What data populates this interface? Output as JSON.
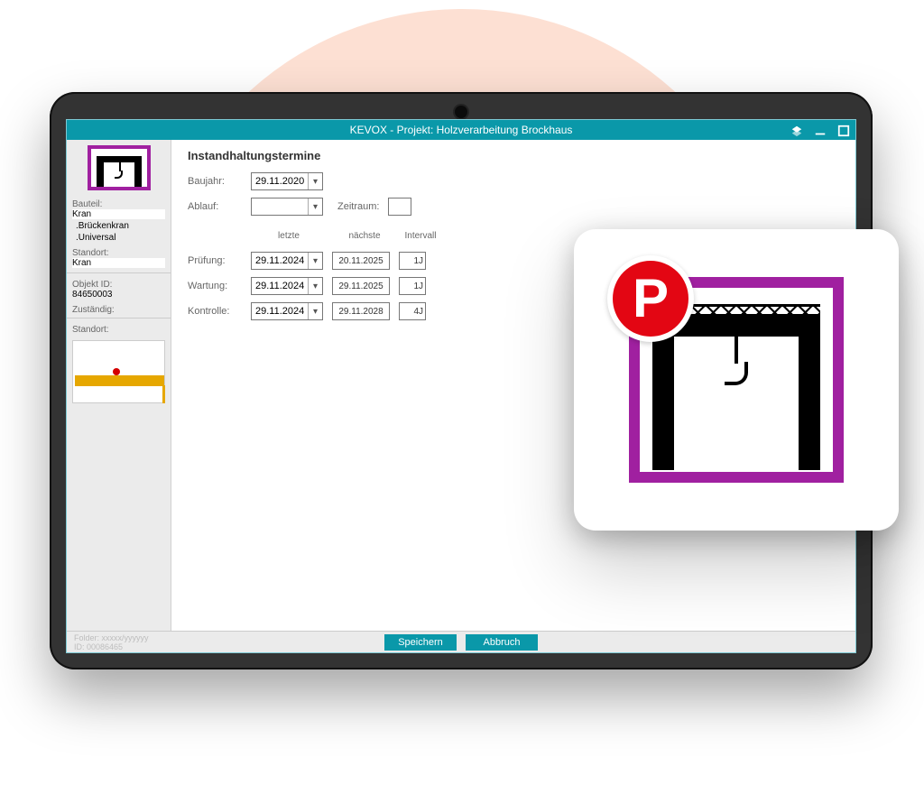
{
  "titlebar": {
    "text": "KEVOX - Projekt: Holzverarbeitung Brockhaus"
  },
  "sidebar": {
    "bauteil_label": "Bauteil:",
    "bauteil_values": [
      "Kran",
      ".Brückenkran",
      ".Universal"
    ],
    "standort_label": "Standort:",
    "standort_value": "Kran",
    "objekt_id_label": "Objekt ID:",
    "objekt_id_value": "84650003",
    "zustaendig_label": "Zuständig:",
    "standort2_label": "Standort:"
  },
  "main": {
    "heading": "Instandhaltungstermine",
    "baujahr_label": "Baujahr:",
    "baujahr_value": "29.11.2020",
    "ablauf_label": "Ablauf:",
    "zeitraum_label": "Zeitraum:",
    "col_letzte": "letzte",
    "col_naechste": "nächste",
    "col_intervall": "Intervall",
    "rows": [
      {
        "label": "Prüfung:",
        "letzte": "29.11.2024",
        "naechste": "20.11.2025",
        "intervall": "1J"
      },
      {
        "label": "Wartung:",
        "letzte": "29.11.2024",
        "naechste": "29.11.2025",
        "intervall": "1J"
      },
      {
        "label": "Kontrolle:",
        "letzte": "29.11.2024",
        "naechste": "29.11.2028",
        "intervall": "4J"
      }
    ]
  },
  "footer": {
    "folder_info": "Folder: xxxxx/yyyyyy",
    "id_info": "ID: 00086465",
    "save": "Speichern",
    "cancel": "Abbruch"
  },
  "overlay": {
    "badge_letter": "P"
  }
}
